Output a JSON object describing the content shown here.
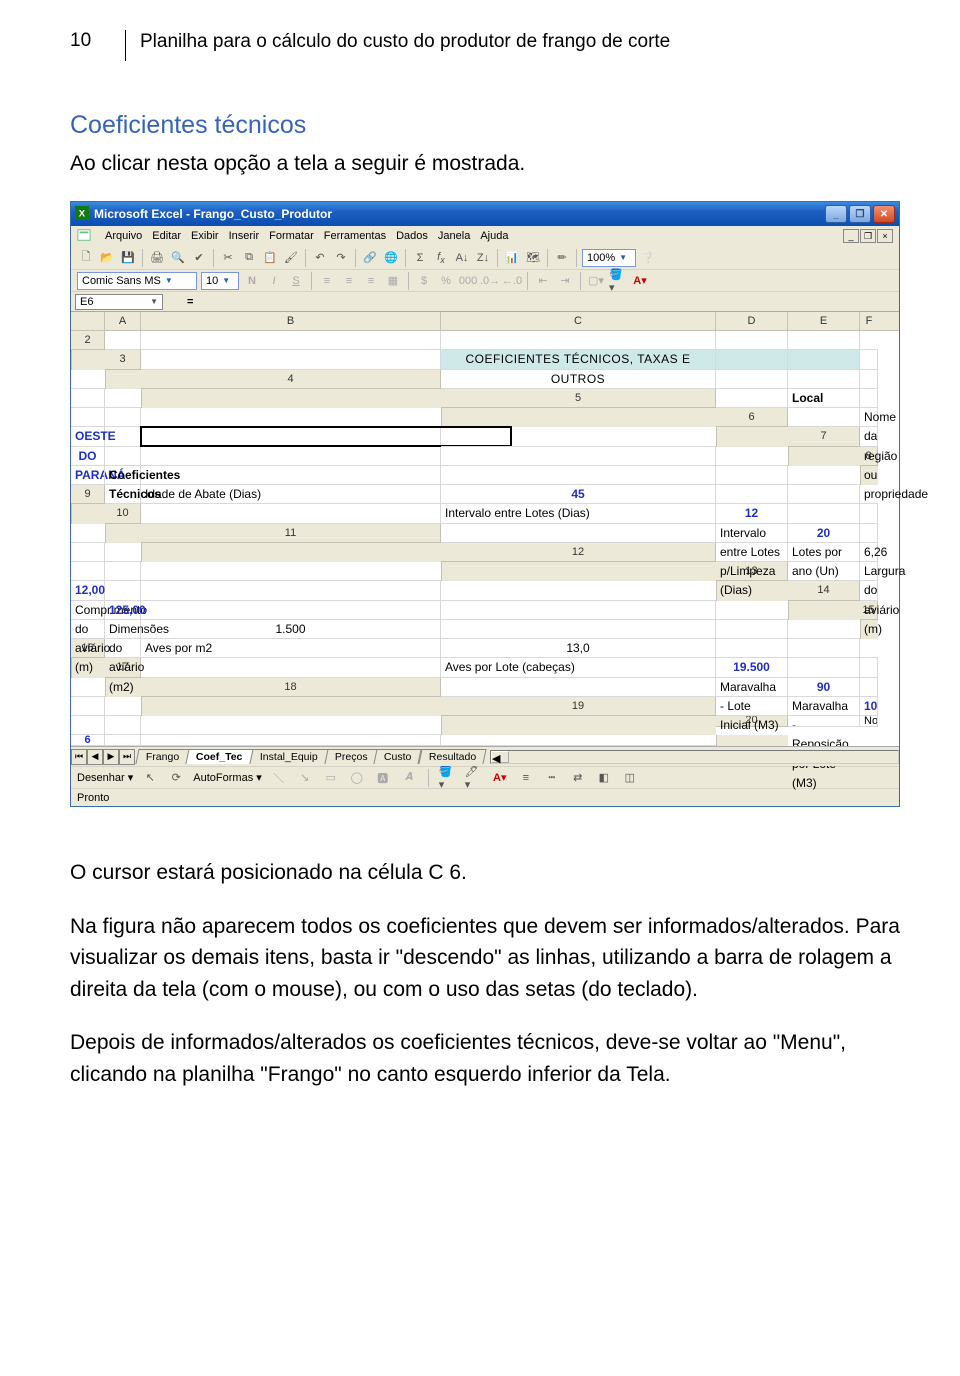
{
  "page_number": "10",
  "doc_title": "Planilha para o cálculo do custo do produtor de frango de corte",
  "section_heading": "Coeficientes técnicos",
  "intro_text": "Ao clicar nesta opção a tela a seguir é mostrada.",
  "para1": "O cursor estará posicionado na célula C 6.",
  "para2": "Na figura não aparecem todos os coeficientes que devem ser informados/alterados. Para visualizar os demais itens, basta ir \"descendo\" as linhas, utilizando a barra de rolagem a direita da tela (com o mouse), ou com o uso das setas (do teclado).",
  "para3": "Depois de informados/alterados os coeficientes técnicos, deve-se voltar ao \"Menu\", clicando na planilha \"Frango\" no canto esquerdo inferior da Tela.",
  "excel": {
    "title": "Microsoft Excel - Frango_Custo_Produtor",
    "menus": [
      "Arquivo",
      "Editar",
      "Exibir",
      "Inserir",
      "Formatar",
      "Ferramentas",
      "Dados",
      "Janela",
      "Ajuda"
    ],
    "font_name": "Comic Sans MS",
    "font_size": "10",
    "zoom": "100%",
    "name_box": "E6",
    "columns": [
      "",
      "A",
      "B",
      "C",
      "D",
      "E",
      "F"
    ],
    "rows": [
      {
        "n": "2",
        "b": "",
        "c": "",
        "cls": ""
      },
      {
        "n": "3",
        "b": "COEFICIENTES TÉCNICOS, TAXAS E OUTROS",
        "c": "",
        "cls": "band"
      },
      {
        "n": "4",
        "b": "",
        "c": "",
        "cls": ""
      },
      {
        "n": "5",
        "b": "Local",
        "c": "",
        "cls": "bold"
      },
      {
        "n": "6",
        "b": "Nome da região ou propriedade",
        "c": "OESTE DO PARANÁ",
        "cls": "val-blue"
      },
      {
        "n": "7",
        "b": "",
        "c": "",
        "cls": ""
      },
      {
        "n": "8",
        "b": "Coeficientes Técnicos",
        "c": "",
        "cls": "bold"
      },
      {
        "n": "9",
        "b": "Idade de Abate (Dias)",
        "c": "45",
        "cls": "val-blue"
      },
      {
        "n": "10",
        "b": "Intervalo entre Lotes (Dias)",
        "c": "12",
        "cls": "val-blue"
      },
      {
        "n": "11",
        "b": "Intervalo entre Lotes p/Limpeza (Dias)",
        "c": "20",
        "cls": "val-blue"
      },
      {
        "n": "12",
        "b": "Lotes por ano  (Un)",
        "c": "6,26",
        "cls": "val"
      },
      {
        "n": "13",
        "b": "Largura do aviário (m)",
        "c": "12,00",
        "cls": "val-blue"
      },
      {
        "n": "14",
        "b": "Comprimento do aviário (m)",
        "c": "125,00",
        "cls": "val-blue"
      },
      {
        "n": "15",
        "b": "Dimensões do aviário (m2)",
        "c": "1.500",
        "cls": "val"
      },
      {
        "n": "16",
        "b": "Aves por m2",
        "c": "13,0",
        "cls": "val"
      },
      {
        "n": "17",
        "b": "Aves por Lote (cabeças)",
        "c": "19.500",
        "cls": "val-blue"
      },
      {
        "n": "18",
        "b": "Maravalha - Lote Inicial (M3)",
        "c": "90",
        "cls": "val-blue"
      },
      {
        "n": "19",
        "b": "Maravalha - Reposição por Lote  (M3)",
        "c": "10",
        "cls": "val-blue"
      },
      {
        "n": "20",
        "b": "No. de lotes para troca de cama  (Un)",
        "c": "6",
        "cls": "val-blue-cut"
      }
    ],
    "tabs": [
      "Frango",
      "Coef_Tec",
      "Instal_Equip",
      "Preços",
      "Custo",
      "Resultado"
    ],
    "active_tab": 1,
    "draw_label": "Desenhar",
    "autoshapes": "AutoFormas",
    "status": "Pronto"
  }
}
